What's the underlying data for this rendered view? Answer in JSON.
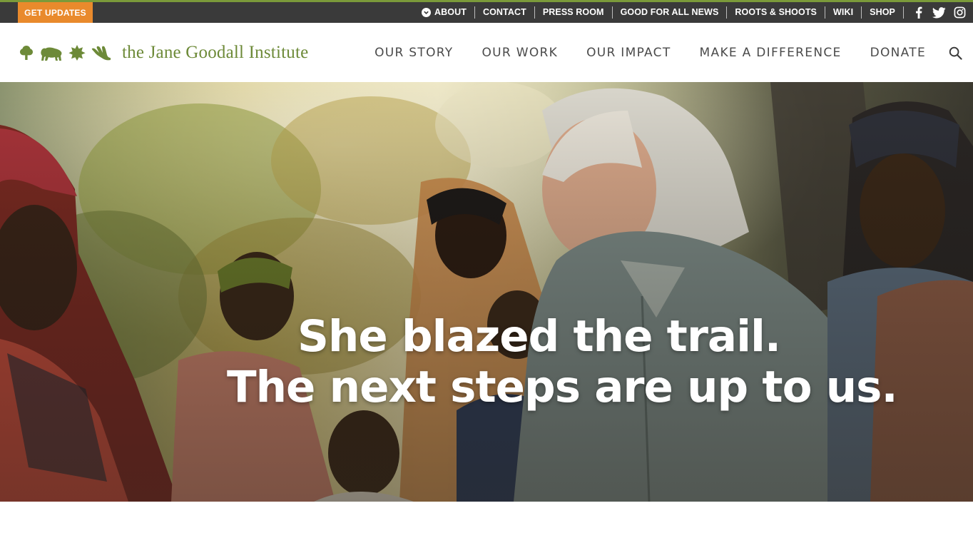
{
  "utility_bar": {
    "cta_label": "GET UPDATES",
    "links": [
      {
        "label": "ABOUT"
      },
      {
        "label": "CONTACT"
      },
      {
        "label": "PRESS ROOM"
      },
      {
        "label": "GOOD FOR ALL NEWS"
      },
      {
        "label": "ROOTS & SHOOTS"
      },
      {
        "label": "WIKI"
      },
      {
        "label": "SHOP"
      }
    ],
    "social_icons": [
      "facebook-icon",
      "twitter-icon",
      "instagram-icon"
    ]
  },
  "header": {
    "logo_text": "the Jane Goodall Institute",
    "nav": [
      {
        "label": "OUR STORY"
      },
      {
        "label": "OUR WORK"
      },
      {
        "label": "OUR IMPACT"
      },
      {
        "label": "MAKE A DIFFERENCE"
      },
      {
        "label": "DONATE"
      }
    ],
    "search_icon": "search-icon"
  },
  "hero": {
    "line1": "She blazed the trail.",
    "line2": "The next steps are up to us."
  },
  "colors": {
    "utility_bg": "#3a3a3a",
    "accent_green": "#7b9a3a",
    "cta_orange": "#e98a2c",
    "logo_green": "#6d8a38",
    "nav_text": "#4a4a4a"
  }
}
